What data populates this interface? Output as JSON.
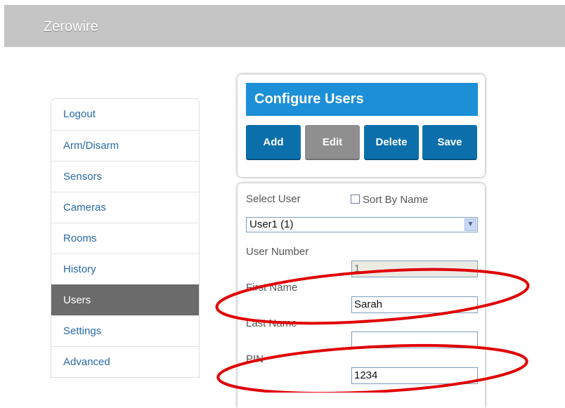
{
  "app": {
    "title": "Zerowire"
  },
  "sidebar": {
    "items": [
      {
        "label": "Logout"
      },
      {
        "label": "Arm/Disarm"
      },
      {
        "label": "Sensors"
      },
      {
        "label": "Cameras"
      },
      {
        "label": "Rooms"
      },
      {
        "label": "History"
      },
      {
        "label": "Users",
        "active": true
      },
      {
        "label": "Settings"
      },
      {
        "label": "Advanced"
      }
    ]
  },
  "header": {
    "title": "Configure Users",
    "buttons": {
      "add": "Add",
      "edit": "Edit",
      "delete": "Delete",
      "save": "Save"
    }
  },
  "form": {
    "select_user_label": "Select User",
    "sort_by_name_label": "Sort By Name",
    "sort_by_name_checked": false,
    "selected_user": "User1 (1)",
    "user_number_label": "User Number",
    "user_number_value": "1",
    "first_name_label": "First Name",
    "first_name_value": "Sarah",
    "last_name_label": "Last Name",
    "last_name_value": "",
    "pin_label": "PIN",
    "pin_value": "1234"
  },
  "colors": {
    "accent": "#1c8fd7",
    "button_blue": "#0b6fab",
    "button_gray": "#8f8f8f",
    "annotation_red": "#e00000"
  }
}
